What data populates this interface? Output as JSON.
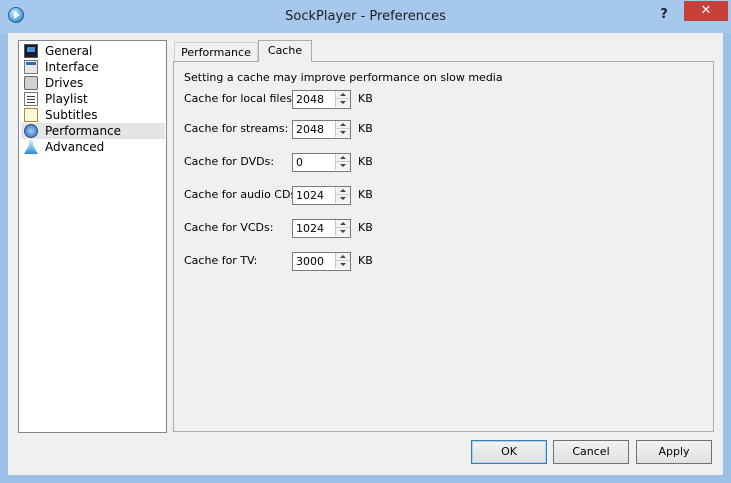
{
  "window": {
    "title": "SockPlayer - Preferences",
    "help": "?",
    "close": "✕"
  },
  "sidebar": {
    "items": [
      {
        "label": "General",
        "icon": "monitor-icon"
      },
      {
        "label": "Interface",
        "icon": "window-icon"
      },
      {
        "label": "Drives",
        "icon": "drive-icon"
      },
      {
        "label": "Playlist",
        "icon": "list-icon"
      },
      {
        "label": "Subtitles",
        "icon": "subtitle-icon"
      },
      {
        "label": "Performance",
        "icon": "gear-icon",
        "selected": true
      },
      {
        "label": "Advanced",
        "icon": "flask-icon"
      }
    ]
  },
  "tabs": [
    {
      "label": "Performance"
    },
    {
      "label": "Cache",
      "active": true
    }
  ],
  "cache": {
    "intro": "Setting a cache may improve performance on slow media",
    "unit": "KB",
    "rows": [
      {
        "label": "Cache for local files:",
        "value": "2048"
      },
      {
        "label": "Cache for streams:",
        "value": "2048"
      },
      {
        "label": "Cache for DVDs:",
        "value": "0"
      },
      {
        "label": "Cache for audio CDs:",
        "value": "1024"
      },
      {
        "label": "Cache for VCDs:",
        "value": "1024"
      },
      {
        "label": "Cache for TV:",
        "value": "3000"
      }
    ]
  },
  "buttons": {
    "ok": "OK",
    "cancel": "Cancel",
    "apply": "Apply"
  }
}
